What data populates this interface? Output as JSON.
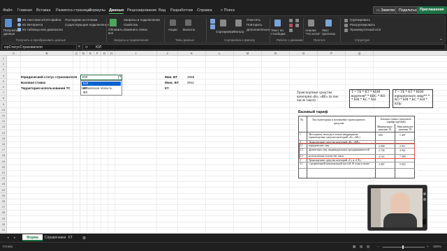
{
  "menu": {
    "tabs": [
      "Файл",
      "Главная",
      "Вставка",
      "Разметка страницы",
      "Формулы",
      "Данные",
      "Рецензирование",
      "Вид",
      "Разработчик",
      "Справка",
      "Поиск"
    ],
    "active_tab": "Данные",
    "notes_button": "Заметки",
    "share_button": "Подельться",
    "present_button": "Приглашение"
  },
  "ribbon": {
    "get_data": "Получить данные",
    "from_text_csv": "Из текстового/CSV-файла",
    "from_web": "Из Интернета",
    "from_table": "Из таблицы или диапазона",
    "recent_sources": "Последние источники",
    "existing_connections": "Существующие подключения",
    "refresh_all": "Обновить все",
    "queries_connections": "Запросы и подключения",
    "properties": "Свойства",
    "edit_links": "Изменить связи",
    "stocks": "Акции",
    "currencies": "Валюты",
    "sort": "Сортировка",
    "filter": "Фильтр",
    "clear": "Очистить",
    "reapply": "Повторить",
    "advanced": "Дополнительно",
    "text_to_columns": "Текст по столбцам",
    "what_if": "Анализ \"что если\"",
    "forecast_sheet": "Лист прогноза",
    "group": "Группировать",
    "ungroup": "Разгруппировать",
    "subtotal": "Промежуточный итог",
    "groups": {
      "get_transform": "Получить и преобразовать данные",
      "queries": "Запросы и подключения",
      "data_types": "Типы данных",
      "sort_filter": "Сортировка и фильтр",
      "data_tools": "Работа с данными",
      "forecast": "Прогноз",
      "structure": "Структура"
    }
  },
  "formula_bar": {
    "name_box": "юрСтатусСтрахователя",
    "formula": "ЮЛ"
  },
  "columns": [
    "A",
    "B",
    "C",
    "D",
    "E",
    "F",
    "G",
    "H",
    "I",
    "J",
    "K",
    "L",
    "M",
    "N",
    "O",
    "P",
    "Q"
  ],
  "rows": [
    "1",
    "2",
    "3",
    "4",
    "5",
    "6",
    "7",
    "8",
    "9",
    "10",
    "11",
    "12",
    "13",
    "14",
    "15",
    "16",
    "17",
    "18",
    "19",
    "20",
    "21",
    "22",
    "23",
    "24",
    "25",
    "26",
    "27",
    "28",
    "29",
    "30",
    "31"
  ],
  "cells": {
    "legal_status_label": "Юридический статус страхователя",
    "legal_status_value": "ЮЛ",
    "base_rate_label": "Базовая ставка",
    "territory_label": "Территория использования ТС",
    "territory_value": "Московская область",
    "min_bt_label": "Мин. БТ",
    "min_bt_value": "2958",
    "max_bt_label": "Макс. БТ",
    "max_bt_value": "2911",
    "kt_label": "КТ"
  },
  "dropdown": {
    "options": [
      "ЮЛ",
      "ИП",
      "ФЛ"
    ],
    "selected": "ЮЛ"
  },
  "textbox_left": "Транспортные средства категории «В», «ВЕ» (в том числе такси)",
  "formula_box_1": "Т = ТБ * КТ * КБМ водителя* * КВС * КО * КМ * КС * КН",
  "formula_box_2": "Т = ТБ * КТ * КБМ юридического лица** * КО * КМ * КС * КН * КПр",
  "tariff": {
    "title": "Базовый тариф",
    "header_no": "№",
    "header_type": "Тип (категория) и назначение транспортного средства",
    "header_rate": "Базовая ставка страхового тарифа (рублей)",
    "header_min": "Минимальное значение ТБ",
    "header_max": "Максимальное значение ТБ",
    "rows": [
      {
        "n": "1",
        "text": "Мотоциклы, мопеды и легкие квадрициклы (транспортные средства категорий «А», «М»)",
        "min": "694",
        "max": "1 407"
      },
      {
        "n": "2",
        "text": "Транспортные средства категорий «В», «ВЕ»:",
        "min": "",
        "max": ""
      },
      {
        "n": "2.1",
        "text": "юридических лиц",
        "min": "2 058",
        "max": "2 911"
      },
      {
        "n": "2.2",
        "text": "физических лиц, индивидуальных предпринимателей",
        "min": "2 746",
        "max": "4 942"
      },
      {
        "n": "2.3",
        "text": "используемые в качестве такси",
        "min": "4 110",
        "max": "7 399"
      },
      {
        "n": "3",
        "text": "Транспортные средства категорий «С» и «СЕ»:",
        "min": "",
        "max": ""
      },
      {
        "n": "3.1",
        "text": "с разрешенной максимальной массой 16 тонн и менее",
        "min": "2 807",
        "max": "5 053"
      }
    ]
  },
  "sheets": [
    "Форма",
    "Справочники",
    "КТ"
  ],
  "active_sheet": "Форма",
  "status": {
    "ready": "Готово",
    "zoom": "100%"
  },
  "colors": {
    "accent": "#1e7145",
    "highlight_box": "#e04a3f",
    "select_blue": "#0b63ce"
  }
}
